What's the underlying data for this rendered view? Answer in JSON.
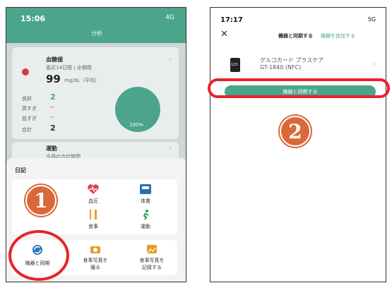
{
  "left": {
    "time": "15:06",
    "status": "4G",
    "title": "分析",
    "glucose": {
      "heading": "血糖値",
      "subtitle": "直近14日間 | 全期間",
      "value": "99",
      "unit": "mg/dL（平均）",
      "rows": [
        {
          "label": "良好",
          "count": "2"
        },
        {
          "label": "高すぎ",
          "count": "–"
        },
        {
          "label": "低すぎ",
          "count": "–"
        },
        {
          "label": "合計",
          "count": "2"
        }
      ],
      "percent": "100%"
    },
    "exercise": {
      "heading": "運動",
      "subtitle": "今週の合計時間"
    },
    "diary_title": "日記",
    "diary_items": [
      {
        "label": "血圧",
        "icon": "heart-pulse-icon"
      },
      {
        "label": "体重",
        "icon": "scale-icon"
      },
      {
        "label": "食事",
        "icon": "fork-knife-icon"
      },
      {
        "label": "運動",
        "icon": "runner-icon"
      }
    ],
    "bottom_items": [
      {
        "label": "機器と同期",
        "icon": "sync-icon"
      },
      {
        "label": "食事写真を\n撮る",
        "icon": "camera-icon"
      },
      {
        "label": "食事写真を\n記録する",
        "icon": "photo-icon"
      }
    ],
    "badge": "1",
    "colors": {
      "accent": "#4aa58c",
      "annotation": "#e8222a",
      "badge": "#d9693a"
    }
  },
  "right": {
    "time": "17:17",
    "status": "5G",
    "header_title": "機器と同期する",
    "add_link": "機器を追加する",
    "device_name": "グルコカード プラスケア",
    "device_model": "GT-1840 (NFC)",
    "device_tag": "123",
    "sync_button": "機器と同期する",
    "badge": "2"
  }
}
